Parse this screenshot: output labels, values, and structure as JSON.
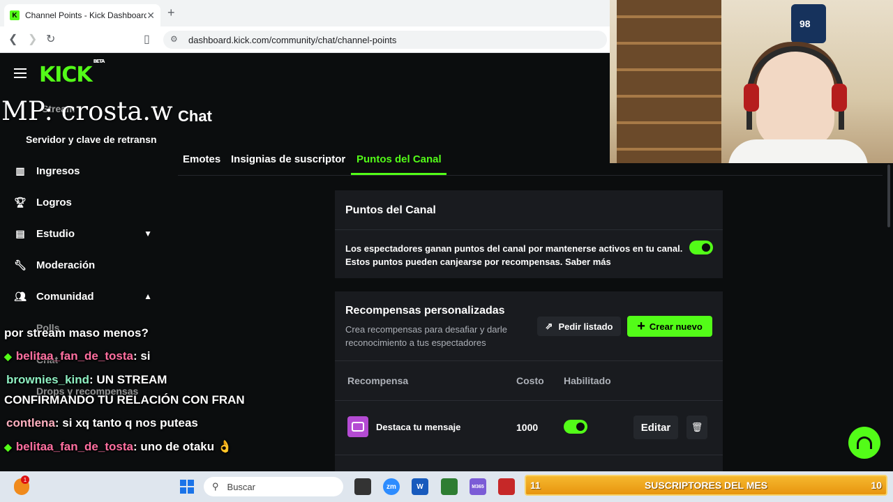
{
  "browser": {
    "tab_title": "Channel Points - Kick Dashboard",
    "tab_close": "✕",
    "new_tab": "+",
    "url": "dashboard.kick.com/community/chat/channel-points"
  },
  "brand": {
    "logo": "KICK",
    "beta": "BETA",
    "accent": "#53fc18"
  },
  "sidebar": {
    "stream_label": "Stream",
    "server_key": "Servidor y clave de retransn",
    "items": [
      {
        "label": "Ingresos",
        "icon": "chart-icon"
      },
      {
        "label": "Logros",
        "icon": "trophy-icon"
      },
      {
        "label": "Estudio",
        "icon": "studio-icon"
      },
      {
        "label": "Moderación",
        "icon": "wrench-icon"
      },
      {
        "label": "Comunidad",
        "icon": "community-icon"
      }
    ],
    "sub_items": [
      "Polls",
      "Chat",
      "Drops y recompensas"
    ]
  },
  "stream_overlay_title": "MP: crosta.w",
  "page": {
    "title": "Chat",
    "tabs": [
      "Emotes",
      "Insignias de suscriptor",
      "Puntos del Canal"
    ],
    "active_tab": 2
  },
  "channel_points": {
    "title": "Puntos del Canal",
    "desc_line1": "Los espectadores ganan puntos del canal por mantenerse activos en tu canal.",
    "desc_line2": "Estos puntos pueden canjearse por recompensas. Saber más",
    "enabled": true
  },
  "custom_rewards": {
    "title": "Recompensas personalizadas",
    "subtitle": "Crea recompensas para desafiar y darle reconocimiento a tus espectadores",
    "list_button": "Pedir listado",
    "new_button": "Crear nuevo",
    "columns": [
      "Recompensa",
      "Costo",
      "Habilitado"
    ],
    "rows": [
      {
        "name": "Destaca tu mensaje",
        "cost": "1000",
        "enabled": true,
        "edit": "Editar"
      }
    ]
  },
  "chat": [
    {
      "user": "",
      "text": "por stream maso menos?"
    },
    {
      "user": "belitaa_fan_de_tosta",
      "text": ": si"
    },
    {
      "user": "brownies_kind",
      "text": ": UN STREAM"
    },
    {
      "user": "",
      "text": "CONFIRMANDO TU RELACIÓN CON FRAN"
    },
    {
      "user": "contlena",
      "text": ": si xq tanto q nos puteas"
    },
    {
      "user": "belitaa_fan_de_tosta",
      "text": ": uno de otaku 👌"
    }
  ],
  "taskbar": {
    "notif_count": "1",
    "search_placeholder": "Buscar",
    "apps": [
      "zm",
      "W",
      "M365"
    ]
  },
  "webcam": {
    "jersey_number": "98"
  },
  "subs_goal": {
    "left_count": "11",
    "label": "SUSCRIPTORES DEL MES",
    "right_count": "10"
  }
}
